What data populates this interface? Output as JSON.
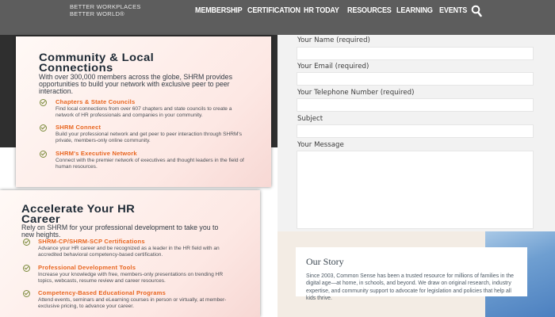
{
  "header": {
    "logo_line1": "BETTER WORKPLACES",
    "logo_line2": "BETTER WORLD®",
    "nav": [
      "MEMBERSHIP",
      "CERTIFICATION",
      "HR TODAY",
      "RESOURCES",
      "LEARNING",
      "EVENTS"
    ],
    "search_icon": "search-icon"
  },
  "card_community": {
    "title_line1": "Community & Local",
    "title_line2": "Connections",
    "intro": "With over 300,000 members across the globe, SHRM provides opportunities to build your network with exclusive peer to peer interaction.",
    "items": [
      {
        "title": "Chapters & State Councils",
        "desc": "Find local connections from over 607 chapters and state councils to create a network of HR professionals and companies in your community."
      },
      {
        "title": "SHRM Connect",
        "desc": "Build your professional network and get peer to peer interaction through SHRM's private, members-only online community."
      },
      {
        "title": "SHRM's Executive Network",
        "desc": "Connect with the premier network of executives and thought leaders in the field of human resources."
      }
    ]
  },
  "card_career": {
    "title_line1": "Accelerate Your HR",
    "title_line2": "Career",
    "intro": "Rely on SHRM for your professional development to take you to new heights.",
    "items": [
      {
        "title": "SHRM-CP/SHRM-SCP Certifications",
        "desc": "Advance your HR career and be recognized as a leader in the HR field with an accredited behavioral competency-based certification."
      },
      {
        "title": "Professional Development Tools",
        "desc": "Increase your knowledge with free, members-only presentations on trending HR topics, webcasts, resume review and career resources."
      },
      {
        "title": "Competency-Based Educational Programs",
        "desc": "Attend events, seminars and eLearning courses in person or virtually, at member-exclusive pricing, to advance your career."
      }
    ]
  },
  "form": {
    "name_label": "Your Name (required)",
    "email_label": "Your Email (required)",
    "phone_label": "Your Telephone Number (required)",
    "subject_label": "Subject",
    "message_label": "Your Message"
  },
  "story": {
    "title": "Our Story",
    "text": "Since 2003, Common Sense has been a trusted resource for millions of families in the digital age—at home, in schools, and beyond. We draw on original research, industry expertise, and community support to advocate for legislation and policies that help all kids thrive."
  }
}
